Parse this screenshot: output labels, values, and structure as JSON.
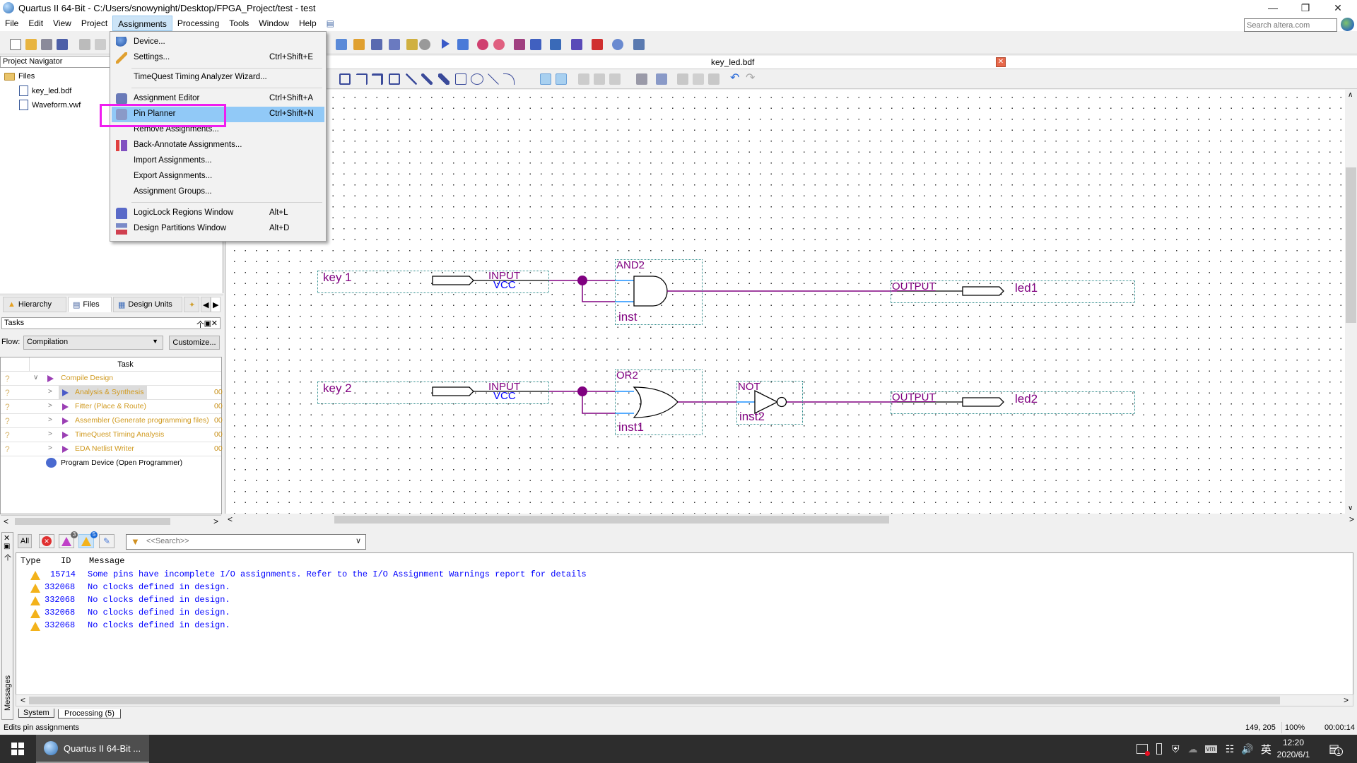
{
  "window": {
    "title": "Quartus II 64-Bit - C:/Users/snowynight/Desktop/FPGA_Project/test - test",
    "controls": {
      "minimize": "—",
      "restore": "❐",
      "close": "✕"
    }
  },
  "menubar": {
    "items": [
      "File",
      "Edit",
      "View",
      "Project",
      "Assignments",
      "Processing",
      "Tools",
      "Window",
      "Help"
    ],
    "active": "Assignments",
    "search_placeholder": "Search altera.com"
  },
  "assignments_menu": {
    "items": [
      {
        "label": "Device...",
        "shortcut": "",
        "icon": "device-icon"
      },
      {
        "label": "Settings...",
        "shortcut": "Ctrl+Shift+E",
        "icon": "settings-icon"
      },
      {
        "label": "TimeQuest Timing Analyzer Wizard...",
        "shortcut": "",
        "icon": ""
      },
      {
        "label": "Assignment Editor",
        "shortcut": "Ctrl+Shift+A",
        "icon": "assignment-editor-icon"
      },
      {
        "label": "Pin Planner",
        "shortcut": "Ctrl+Shift+N",
        "icon": "pin-planner-icon",
        "highlighted": true
      },
      {
        "label": "Remove Assignments...",
        "shortcut": "",
        "icon": ""
      },
      {
        "label": "Back-Annotate Assignments...",
        "shortcut": "",
        "icon": "back-annotate-icon"
      },
      {
        "label": "Import Assignments...",
        "shortcut": "",
        "icon": ""
      },
      {
        "label": "Export Assignments...",
        "shortcut": "",
        "icon": ""
      },
      {
        "label": "Assignment Groups...",
        "shortcut": "",
        "icon": ""
      },
      {
        "label": "LogicLock Regions Window",
        "shortcut": "Alt+L",
        "icon": "logiclock-icon"
      },
      {
        "label": "Design Partitions Window",
        "shortcut": "Alt+D",
        "icon": "design-partitions-icon"
      }
    ]
  },
  "project_navigator": {
    "title": "Project Navigator",
    "folder": "Files",
    "files": [
      "key_led.bdf",
      "Waveform.vwf"
    ],
    "tabs": [
      "Hierarchy",
      "Files",
      "Design Units"
    ],
    "active_tab": "Files"
  },
  "tasks": {
    "title": "Tasks",
    "flow_label": "Flow:",
    "flow_value": "Compilation",
    "customize_label": "Customize...",
    "column_header": "Task",
    "rows": [
      {
        "status": "?",
        "label": "Compile Design",
        "time": "",
        "level": 0,
        "expanded": true
      },
      {
        "status": "?",
        "label": "Analysis & Synthesis",
        "time": "00",
        "level": 1,
        "selected": true
      },
      {
        "status": "?",
        "label": "Fitter (Place & Route)",
        "time": "00",
        "level": 1
      },
      {
        "status": "?",
        "label": "Assembler (Generate programming files)",
        "time": "00",
        "level": 1
      },
      {
        "status": "?",
        "label": "TimeQuest Timing Analysis",
        "time": "00",
        "level": 1
      },
      {
        "status": "?",
        "label": "EDA Netlist Writer",
        "time": "00",
        "level": 1
      },
      {
        "status": "",
        "label": "Program Device (Open Programmer)",
        "time": "",
        "level": 0
      }
    ]
  },
  "document": {
    "tab_title": "key_led.bdf",
    "schematic": {
      "inputs": [
        {
          "name": "key 1",
          "type": "INPUT",
          "default": "VCC"
        },
        {
          "name": "key 2",
          "type": "INPUT",
          "default": "VCC"
        }
      ],
      "gates": [
        {
          "type": "AND2",
          "instance": "inst"
        },
        {
          "type": "OR2",
          "instance": "inst1"
        },
        {
          "type": "NOT",
          "instance": "inst2"
        }
      ],
      "outputs": [
        {
          "name": "led1",
          "type": "OUTPUT"
        },
        {
          "name": "led2",
          "type": "OUTPUT"
        }
      ]
    }
  },
  "messages": {
    "filter_all": "All",
    "badge_critical": "3",
    "badge_warning": "5",
    "search_placeholder": "<<Search>>",
    "columns": [
      "Type",
      "ID",
      "Message"
    ],
    "rows": [
      {
        "type": "warning",
        "id": "15714",
        "message": "Some pins have incomplete I/O assignments. Refer to the I/O Assignment Warnings report for details"
      },
      {
        "type": "warning",
        "id": "332068",
        "message": "No clocks defined in design."
      },
      {
        "type": "warning",
        "id": "332068",
        "message": "No clocks defined in design."
      },
      {
        "type": "warning",
        "id": "332068",
        "message": "No clocks defined in design."
      },
      {
        "type": "warning",
        "id": "332068",
        "message": "No clocks defined in design."
      }
    ],
    "side_label": "Messages",
    "tabs": [
      "System",
      "Processing (5)"
    ]
  },
  "statusbar": {
    "text": "Edits pin assignments",
    "coords": "149, 205",
    "zoom": "100%",
    "elapsed": "00:00:14"
  },
  "taskbar": {
    "app_label": "Quartus II 64-Bit ...",
    "ime": "英",
    "time": "12:20",
    "date": "2020/6/1",
    "notifications": "1"
  },
  "colors": {
    "menu_highlight": "#91c9f7",
    "annotation_box": "#f01df0",
    "wire": "#800080",
    "port_line": "#1e90ff",
    "task_text": "#d09a20",
    "message_text": "#0000ff"
  }
}
